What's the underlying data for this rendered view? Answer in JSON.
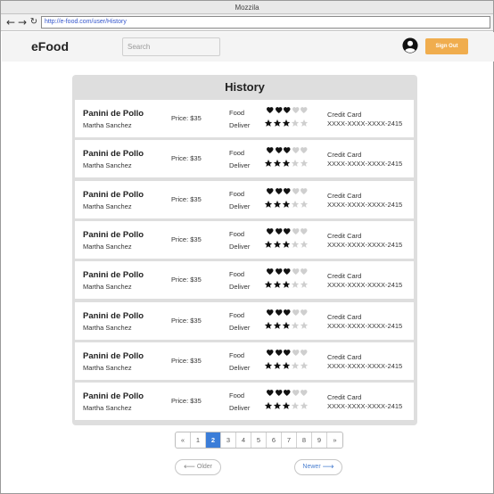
{
  "window": {
    "title": "Mozzila"
  },
  "browser": {
    "back_icon": "arrow-left-icon",
    "forward_icon": "arrow-right-icon",
    "reload_icon": "reload-icon",
    "url": "http://e-food.com/user/History"
  },
  "header": {
    "brand": "eFood",
    "search_placeholder": "Search",
    "avatar_icon": "user-avatar-icon",
    "signout_label": "Sign Out",
    "accent_color": "#f0ad4e"
  },
  "history": {
    "title": "History",
    "food_label": "Food",
    "deliver_label": "Deliver",
    "orders": [
      {
        "dish": "Panini de Pollo",
        "customer": "Martha Sanchez",
        "price": "Price: $35",
        "food_rating": 3,
        "delivery_rating": 3,
        "payment": "Credit Card",
        "card": "XXXX-XXXX-XXXX-2415"
      },
      {
        "dish": "Panini de Pollo",
        "customer": "Martha Sanchez",
        "price": "Price: $35",
        "food_rating": 3,
        "delivery_rating": 3,
        "payment": "Credit Card",
        "card": "XXXX-XXXX-XXXX-2415"
      },
      {
        "dish": "Panini de Pollo",
        "customer": "Martha Sanchez",
        "price": "Price: $35",
        "food_rating": 3,
        "delivery_rating": 3,
        "payment": "Credit Card",
        "card": "XXXX-XXXX-XXXX-2415"
      },
      {
        "dish": "Panini de Pollo",
        "customer": "Martha Sanchez",
        "price": "Price: $35",
        "food_rating": 3,
        "delivery_rating": 3,
        "payment": "Credit Card",
        "card": "XXXX-XXXX-XXXX-2415"
      },
      {
        "dish": "Panini de Pollo",
        "customer": "Martha Sanchez",
        "price": "Price: $35",
        "food_rating": 3,
        "delivery_rating": 3,
        "payment": "Credit Card",
        "card": "XXXX-XXXX-XXXX-2415"
      },
      {
        "dish": "Panini de Pollo",
        "customer": "Martha Sanchez",
        "price": "Price: $35",
        "food_rating": 3,
        "delivery_rating": 3,
        "payment": "Credit Card",
        "card": "XXXX-XXXX-XXXX-2415"
      },
      {
        "dish": "Panini de Pollo",
        "customer": "Martha Sanchez",
        "price": "Price: $35",
        "food_rating": 3,
        "delivery_rating": 3,
        "payment": "Credit Card",
        "card": "XXXX-XXXX-XXXX-2415"
      },
      {
        "dish": "Panini de Pollo",
        "customer": "Martha Sanchez",
        "price": "Price: $35",
        "food_rating": 3,
        "delivery_rating": 3,
        "payment": "Credit Card",
        "card": "XXXX-XXXX-XXXX-2415"
      }
    ],
    "rating_max": 5
  },
  "pagination": {
    "pages": [
      "«",
      "1",
      "2",
      "3",
      "4",
      "5",
      "6",
      "7",
      "8",
      "9",
      "»"
    ],
    "active": "2",
    "active_color": "#3b7dd8"
  },
  "pager": {
    "older_label": "Older",
    "newer_label": "Newer"
  }
}
